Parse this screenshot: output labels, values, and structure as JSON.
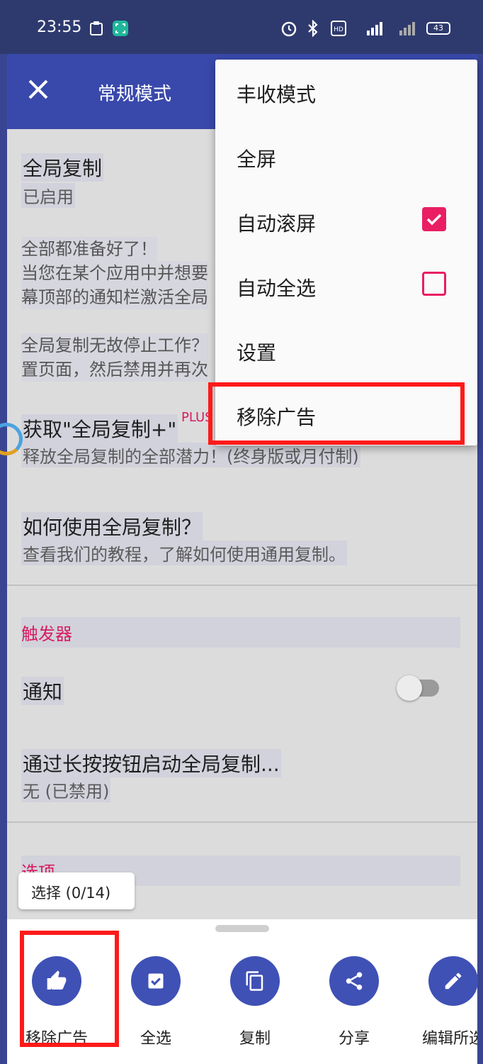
{
  "status_bar": {
    "time": "23:55",
    "battery": "43",
    "icons": [
      "clipboard-icon",
      "scan-icon",
      "alarm-icon",
      "bluetooth-icon",
      "hd-icon",
      "signal-icon",
      "signal-icon-2",
      "battery-icon"
    ]
  },
  "app_bar": {
    "title": "常规模式",
    "close_icon": "close-icon"
  },
  "settings": {
    "global_copy": {
      "title": "全局复制",
      "subtitle": "已启用"
    },
    "ready_text": {
      "line1": "全部都准备好了！",
      "line2": "当您在某个应用中并想要",
      "line3": "幕顶部的通知栏激活全局",
      "line4": "全局复制无故停止工作？",
      "line5": "置页面，然后禁用并再次"
    },
    "plus": {
      "title": "获取\"全局复制+\"",
      "badge": "PLUS",
      "subtitle": "释放全局复制的全部潜力！(终身版或月付制)"
    },
    "howto": {
      "title": "如何使用全局复制？",
      "subtitle": "查看我们的教程，了解如何使用通用复制。"
    },
    "triggers_section": "触发器",
    "notification": {
      "title": "通知",
      "enabled": false
    },
    "long_press": {
      "title": "通过长按按钮启动全局复制...",
      "subtitle": "无 (已禁用)"
    },
    "options_section": "选项"
  },
  "menu": {
    "items": [
      {
        "label": "丰收模式"
      },
      {
        "label": "全屏"
      },
      {
        "label": "自动滚屏",
        "checked": true
      },
      {
        "label": "自动全选",
        "checked": false
      },
      {
        "label": "设置"
      },
      {
        "label": "移除广告"
      }
    ]
  },
  "selection_chip": "选择 (0/14)",
  "bottom_actions": [
    {
      "label": "移除广告",
      "icon": "thumbs-up-icon"
    },
    {
      "label": "全选",
      "icon": "check-box-icon"
    },
    {
      "label": "复制",
      "icon": "copy-icon"
    },
    {
      "label": "分享",
      "icon": "share-icon"
    },
    {
      "label": "编辑所选",
      "icon": "edit-icon"
    }
  ],
  "colors": {
    "primary": "#3949ab",
    "accent": "#e91e63",
    "highlight": "#ff1a1a"
  }
}
